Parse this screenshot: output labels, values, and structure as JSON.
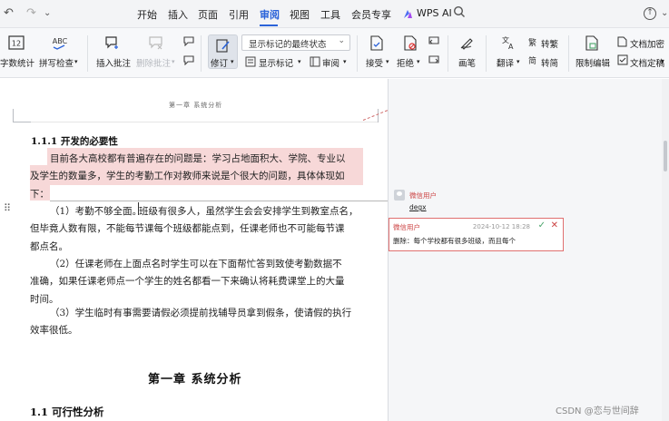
{
  "menubar": {
    "tabs": [
      "开始",
      "插入",
      "页面",
      "引用",
      "审阅",
      "视图",
      "工具",
      "会员专享"
    ],
    "active_tab": "审阅",
    "wps_ai": "WPS AI"
  },
  "ribbon": {
    "word_count": "字数统计",
    "spell_check": "拼写检查",
    "insert_comment": "插入批注",
    "delete_comment": "删除批注",
    "revise": "修订",
    "display_state": "显示标记的最终状态",
    "show_markup": "显示标记",
    "review": "审阅",
    "accept": "接受",
    "reject": "拒绝",
    "pen": "画笔",
    "translate": "翻译",
    "to_traditional": "转繁",
    "to_simplified": "转简",
    "restrict_edit": "限制编辑",
    "doc_encrypt": "文档加密",
    "doc_finalize": "文档定稿"
  },
  "document": {
    "page_header": "第一章  系统分析",
    "heading": "1.1.1  开发的必要性",
    "para1_line1": "目前各大高校都有普遍存在的问题是：学习占地面积大、学院、专业以",
    "para1_line2": "及学生的数量多，学生的考勤工作对教师来说是个很大的问题，具体体现如",
    "para1_line3": "下：",
    "item1_line1_a": "（1）考勤不够全面。",
    "item1_line1_b": "班级有很多人，虽然学生会会安排学生到教室点名，",
    "item1_line2": "但毕竟人数有限，不能每节课每个班级都能点到，任课老师也不可能每节课",
    "item1_line3": "都点名。",
    "item2_line1": "（2）任课老师在上面点名时学生可以在下面帮忙答到致使考勤数据不",
    "item2_line2": "准确，如果任课老师点一个学生的姓名都看一下来确认将耗费课堂上的大量",
    "item2_line3": "时间。",
    "item3_line1": "（3）学生临时有事需要请假必须提前找辅导员拿到假条，使请假的执行",
    "item3_line2": "效率很低。",
    "chapter_title": "第一章  系统分析",
    "section_title": "1.1  可行性分析"
  },
  "comments": {
    "comment1_user": "微信用户",
    "comment1_text": "degx",
    "deletion_user": "微信用户",
    "deletion_date": "2024-10-12 18:28",
    "deletion_text": "删除：每个学校都有很多班级，而且每个"
  },
  "watermark": "CSDN @恋与世间辞",
  "colors": {
    "accent": "#2b63d9",
    "highlight": "#f7d8d8",
    "comment_red": "#c44444"
  }
}
